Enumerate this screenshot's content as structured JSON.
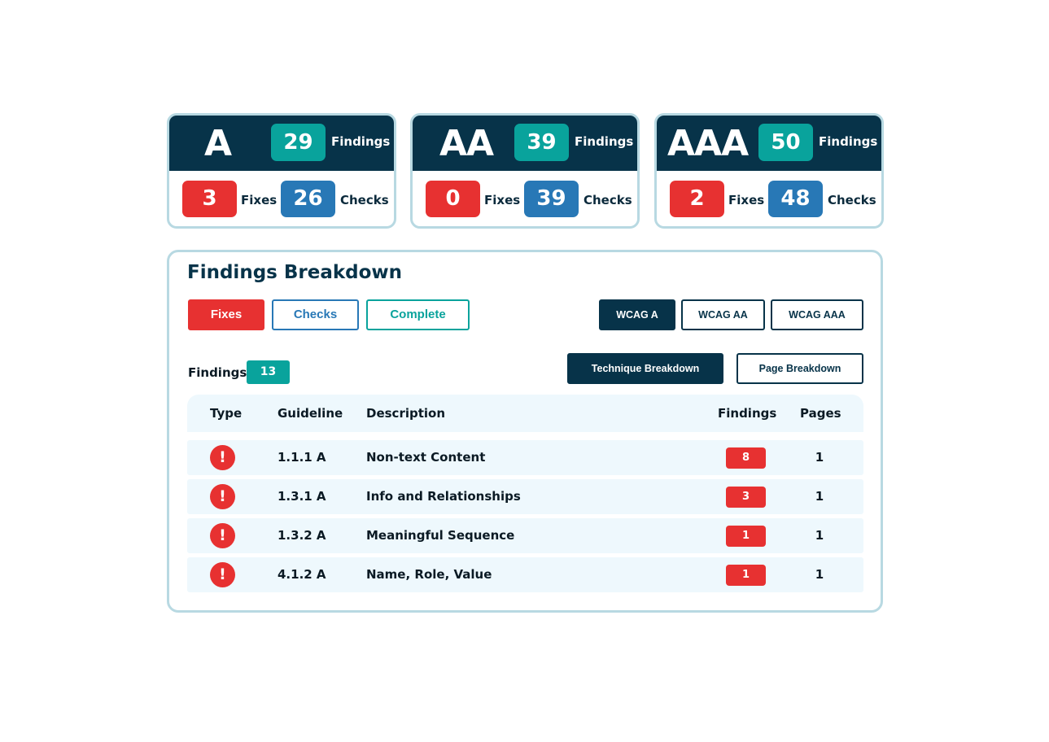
{
  "colors": {
    "navy": "#073349",
    "teal": "#09a39c",
    "red": "#e73131",
    "blue": "#2878b6",
    "border": "#b8d9e2",
    "row_bg": "#eef8fd"
  },
  "levels": [
    {
      "name": "A",
      "findings": "29",
      "findings_label": "Findings",
      "fixes": "3",
      "fixes_label": "Fixes",
      "checks": "26",
      "checks_label": "Checks"
    },
    {
      "name": "AA",
      "findings": "39",
      "findings_label": "Findings",
      "fixes": "0",
      "fixes_label": "Fixes",
      "checks": "39",
      "checks_label": "Checks"
    },
    {
      "name": "AAA",
      "findings": "50",
      "findings_label": "Findings",
      "fixes": "2",
      "fixes_label": "Fixes",
      "checks": "48",
      "checks_label": "Checks"
    }
  ],
  "breakdown": {
    "title": "Findings Breakdown",
    "type_filters": [
      "Fixes",
      "Checks",
      "Complete"
    ],
    "level_filters": [
      "WCAG A",
      "WCAG AA",
      "WCAG AAA"
    ],
    "active_level": "WCAG A",
    "view_buttons": [
      "Technique Breakdown",
      "Page Breakdown"
    ],
    "active_view": "Technique Breakdown",
    "findings_label": "Findings",
    "findings_count": "13",
    "columns": [
      "Type",
      "Guideline",
      "Description",
      "Findings",
      "Pages"
    ],
    "rows": [
      {
        "type_icon": "error-icon",
        "guideline": "1.1.1 A",
        "description": "Non-text Content",
        "findings": "8",
        "pages": "1"
      },
      {
        "type_icon": "error-icon",
        "guideline": "1.3.1 A",
        "description": "Info and Relationships",
        "findings": "3",
        "pages": "1"
      },
      {
        "type_icon": "error-icon",
        "guideline": "1.3.2 A",
        "description": "Meaningful Sequence",
        "findings": "1",
        "pages": "1"
      },
      {
        "type_icon": "error-icon",
        "guideline": "4.1.2 A",
        "description": "Name, Role, Value",
        "findings": "1",
        "pages": "1"
      }
    ],
    "error_glyph": "!"
  }
}
